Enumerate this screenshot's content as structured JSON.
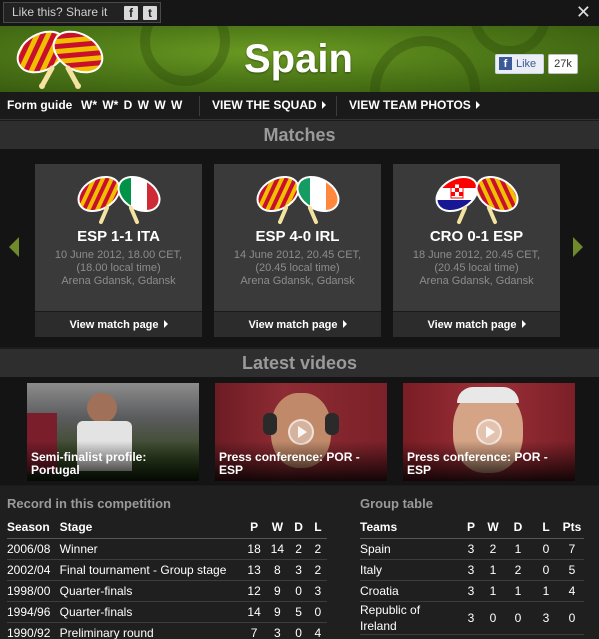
{
  "share": {
    "label": "Like this? Share it"
  },
  "header": {
    "title": "Spain",
    "like_label": "Like",
    "like_count": "27k"
  },
  "nav": {
    "form_label": "Form guide",
    "form": "W* W* D W W W",
    "squad_link": "VIEW THE SQUAD",
    "photos_link": "VIEW TEAM PHOTOS"
  },
  "matches": {
    "heading": "Matches",
    "items": [
      {
        "score": "ESP  1-1  ITA",
        "date": "10 June 2012, 18.00 CET, (18.00 local time)",
        "venue": "Arena Gdansk, Gdansk",
        "link": "View match page"
      },
      {
        "score": "ESP  4-0  IRL",
        "date": "14 June 2012, 20.45 CET, (20.45 local time)",
        "venue": "Arena Gdansk, Gdansk",
        "link": "View match page"
      },
      {
        "score": "CRO  0-1  ESP",
        "date": "18 June 2012, 20.45 CET, (20.45 local time)",
        "venue": "Arena Gdansk, Gdansk",
        "link": "View match page"
      }
    ]
  },
  "videos": {
    "heading": "Latest videos",
    "items": [
      {
        "caption": "Semi-finalist profile: Portugal"
      },
      {
        "caption": "Press conference: POR - ESP"
      },
      {
        "caption": "Press conference: POR - ESP"
      }
    ]
  },
  "record": {
    "heading": "Record in this competition",
    "columns": [
      "Season",
      "Stage",
      "P",
      "W",
      "D",
      "L"
    ],
    "rows": [
      [
        "2006/08",
        "Winner",
        "18",
        "14",
        "2",
        "2"
      ],
      [
        "2002/04",
        "Final tournament - Group stage",
        "13",
        "8",
        "3",
        "2"
      ],
      [
        "1998/00",
        "Quarter-finals",
        "12",
        "9",
        "0",
        "3"
      ],
      [
        "1994/96",
        "Quarter-finals",
        "14",
        "9",
        "5",
        "0"
      ],
      [
        "1990/92",
        "Preliminary round",
        "7",
        "3",
        "0",
        "4"
      ]
    ]
  },
  "group": {
    "heading": "Group table",
    "columns": [
      "Teams",
      "P",
      "W",
      "D",
      "L",
      "Pts"
    ],
    "rows": [
      [
        "Spain",
        "3",
        "2",
        "1",
        "0",
        "7"
      ],
      [
        "Italy",
        "3",
        "1",
        "2",
        "0",
        "5"
      ],
      [
        "Croatia",
        "3",
        "1",
        "1",
        "1",
        "4"
      ],
      [
        "Republic of Ireland",
        "3",
        "0",
        "0",
        "3",
        "0"
      ]
    ]
  },
  "colors": {
    "spain_red": "#c8102e",
    "spain_yellow": "#f1bf00",
    "header_green": "#4f7a18",
    "arrow_green": "#6f8a2a"
  },
  "icons": [
    "facebook-icon",
    "twitter-icon",
    "close-icon",
    "play-icon",
    "arrow-left-icon",
    "arrow-right-icon"
  ]
}
